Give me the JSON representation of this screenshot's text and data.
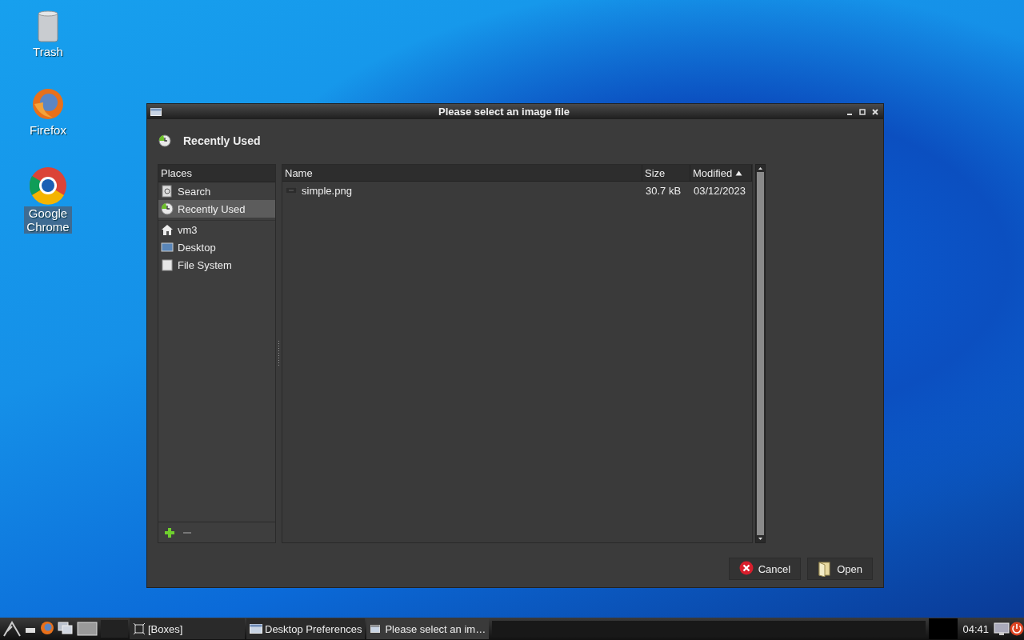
{
  "desktop_icons": [
    {
      "label": "Trash",
      "kind": "trash",
      "selected": false
    },
    {
      "label": "Firefox",
      "kind": "firefox",
      "selected": false
    },
    {
      "label": "Google Chrome",
      "kind": "chrome",
      "selected": true
    }
  ],
  "dialog": {
    "title": "Please select an image file",
    "location": "Recently Used",
    "places": {
      "header": "Places",
      "items": [
        {
          "label": "Search",
          "kind": "search",
          "selected": false,
          "separator_before": false
        },
        {
          "label": "Recently Used",
          "kind": "recent",
          "selected": true,
          "separator_before": false
        },
        {
          "label": "vm3",
          "kind": "home",
          "selected": false,
          "separator_before": true
        },
        {
          "label": "Desktop",
          "kind": "desktop",
          "selected": false,
          "separator_before": false
        },
        {
          "label": "File System",
          "kind": "drive",
          "selected": false,
          "separator_before": false
        }
      ]
    },
    "files": {
      "columns": [
        {
          "label": "Name",
          "sorted": false
        },
        {
          "label": "Size",
          "sorted": false
        },
        {
          "label": "Modified",
          "sorted": true
        }
      ],
      "rows": [
        {
          "name": "simple.png",
          "size": "30.7 kB",
          "modified": "03/12/2023",
          "selected": false
        }
      ]
    },
    "buttons": [
      {
        "label": "Cancel",
        "kind": "cancel"
      },
      {
        "label": "Open",
        "kind": "open"
      }
    ]
  },
  "taskbar": {
    "launchers": [
      {
        "kind": "menu"
      },
      {
        "kind": "desktop"
      },
      {
        "kind": "firefox"
      },
      {
        "kind": "windows"
      },
      {
        "kind": "workspace"
      }
    ],
    "tasks": [
      {
        "label": "[Boxes]",
        "kind": "boxes",
        "selected": false
      },
      {
        "label": "Desktop Preferences",
        "kind": "window",
        "selected": false
      },
      {
        "label": "Please select an im…",
        "kind": "dialog",
        "selected": true
      }
    ],
    "clock": "04:41"
  }
}
